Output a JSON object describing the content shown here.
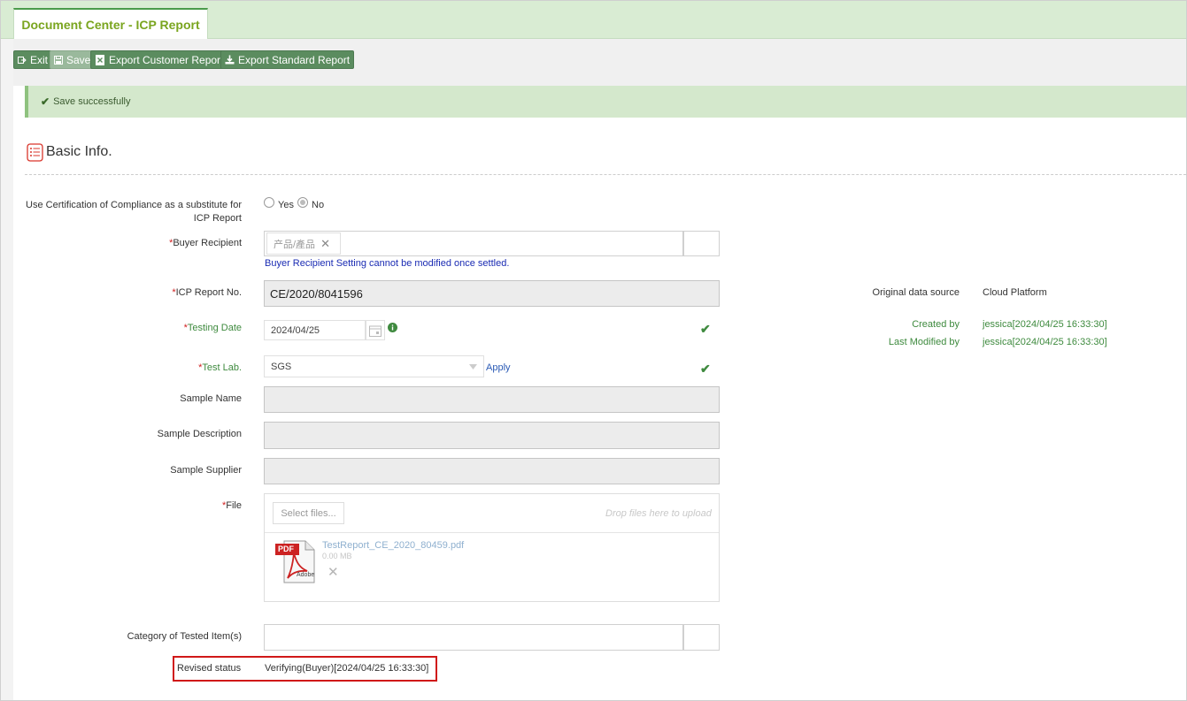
{
  "tab": {
    "title": "Document Center - ICP Report"
  },
  "toolbar": {
    "exit": "Exit",
    "save": "Save",
    "export_customer": "Export Customer Report",
    "export_standard": "Export Standard Report"
  },
  "alert": {
    "message": "Save successfully"
  },
  "section": {
    "title": "Basic Info."
  },
  "form": {
    "coc_label_line1": "Use Certification of Compliance as a substitute for",
    "coc_label_line2": "ICP Report",
    "coc_yes": "Yes",
    "coc_no": "No",
    "coc_selected": "No",
    "buyer_label": "Buyer Recipient",
    "buyer_tag": "产品/產品",
    "buyer_hint": "Buyer Recipient Setting cannot be modified once settled.",
    "icp_label": "ICP Report No.",
    "icp_value": "CE/2020/8041596",
    "testing_date_label": "Testing Date",
    "testing_date_value": "2024/04/25",
    "test_lab_label": "Test Lab.",
    "test_lab_value": "SGS",
    "apply": "Apply",
    "sample_name_label": "Sample Name",
    "sample_desc_label": "Sample Description",
    "sample_supplier_label": "Sample Supplier",
    "file_label": "File",
    "select_files": "Select files...",
    "drop_hint": "Drop files here to upload",
    "file_name": "TestReport_CE_2020_80459.pdf",
    "file_size": "0.00 MB",
    "pdf_badge": "PDF",
    "pdf_brand": "Adobe",
    "category_label": "Category of Tested Item(s)",
    "revised_label": "Revised status",
    "revised_value": "Verifying(Buyer)[2024/04/25 16:33:30]",
    "required_mark": "*"
  },
  "meta": {
    "source_label": "Original data source",
    "source_value": "Cloud Platform",
    "created_label": "Created by",
    "created_value": "jessica[2024/04/25 16:33:30]",
    "modified_label": "Last Modified by",
    "modified_value": "jessica[2024/04/25 16:33:30]"
  },
  "colors": {
    "accent_green": "#5b8c5f",
    "tab_text": "#7aa51f",
    "required": "#d02020",
    "hint_blue": "#1a2bb3",
    "highlight_red": "#d01818"
  }
}
